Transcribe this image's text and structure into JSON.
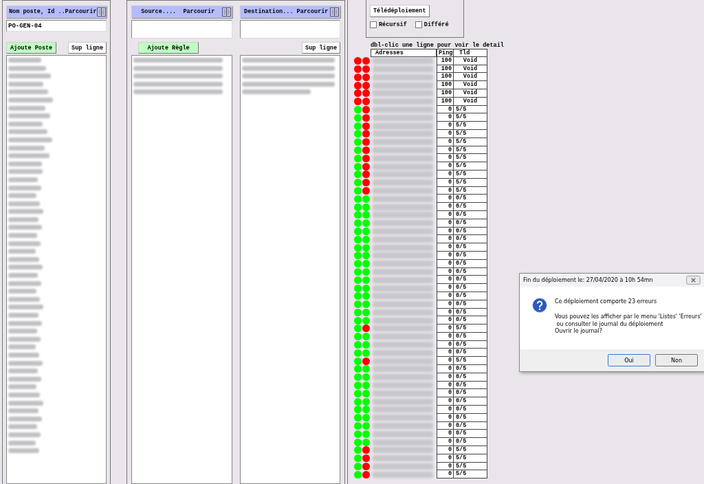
{
  "host_panel": {
    "header": "Nom poste, Id ..Parcourir",
    "value": "PO-GEN-04",
    "buttons": [
      {
        "label": "Ajoute Poste",
        "kind": "accent"
      },
      {
        "label": "Sup ligne",
        "kind": "plain"
      }
    ]
  },
  "rules_panel": {
    "source_header": "Source....  Parcourir",
    "destination_header": "Destination... Parcourir",
    "buttons": [
      {
        "label": "Ajoute Règle",
        "kind": "accent"
      },
      {
        "label": "Sup ligne",
        "kind": "plain"
      }
    ]
  },
  "deploy": {
    "button": "Télédéploiement",
    "options": [
      {
        "label": "Récursif",
        "checked": false
      },
      {
        "label": "Différé",
        "checked": false
      }
    ]
  },
  "hint": "dbl-clic une ligne pour voir le detail",
  "table": {
    "columns": [
      "Adresses",
      "Ping",
      "Tld"
    ],
    "rows": [
      {
        "dots": [
          {
            "color": "#ff0000"
          },
          {
            "color": "#ff0000"
          }
        ],
        "ping": "100",
        "tld": "Void"
      },
      {
        "dots": [
          {
            "color": "#ff0000"
          },
          {
            "color": "#ff0000"
          }
        ],
        "ping": "100",
        "tld": "Void"
      },
      {
        "dots": [
          {
            "color": "#ff0000"
          },
          {
            "color": "#ff0000"
          }
        ],
        "ping": "100",
        "tld": "Void"
      },
      {
        "dots": [
          {
            "color": "#ff0000"
          },
          {
            "color": "#ff0000"
          }
        ],
        "ping": "100",
        "tld": "Void"
      },
      {
        "dots": [
          {
            "color": "#ff0000"
          },
          {
            "color": "#ff0000"
          }
        ],
        "ping": "100",
        "tld": "Void"
      },
      {
        "dots": [
          {
            "color": "#ff0000"
          },
          {
            "color": "#ff0000"
          }
        ],
        "ping": "100",
        "tld": "Void"
      },
      {
        "dots": [
          {
            "color": "#00ff00"
          },
          {
            "color": "#ff0000"
          }
        ],
        "ping": "0",
        "tld": "5/5"
      },
      {
        "dots": [
          {
            "color": "#00ff00"
          },
          {
            "color": "#ff0000"
          }
        ],
        "ping": "0",
        "tld": "5/5"
      },
      {
        "dots": [
          {
            "color": "#00ff00"
          },
          {
            "color": "#ff0000"
          }
        ],
        "ping": "0",
        "tld": "5/5"
      },
      {
        "dots": [
          {
            "color": "#00ff00"
          },
          {
            "color": "#ff0000"
          }
        ],
        "ping": "0",
        "tld": "5/5"
      },
      {
        "dots": [
          {
            "color": "#00ff00"
          },
          {
            "color": "#ff0000"
          }
        ],
        "ping": "0",
        "tld": "5/5"
      },
      {
        "dots": [
          {
            "color": "#00ff00"
          },
          {
            "color": "#ff0000"
          }
        ],
        "ping": "0",
        "tld": "5/5"
      },
      {
        "dots": [
          {
            "color": "#00ff00"
          },
          {
            "color": "#ff0000"
          }
        ],
        "ping": "0",
        "tld": "5/5"
      },
      {
        "dots": [
          {
            "color": "#00ff00"
          },
          {
            "color": "#ff0000"
          }
        ],
        "ping": "0",
        "tld": "5/5"
      },
      {
        "dots": [
          {
            "color": "#00ff00"
          },
          {
            "color": "#ff0000"
          }
        ],
        "ping": "0",
        "tld": "5/5"
      },
      {
        "dots": [
          {
            "color": "#00ff00"
          },
          {
            "color": "#ff0000"
          }
        ],
        "ping": "0",
        "tld": "5/5"
      },
      {
        "dots": [
          {
            "color": "#00ff00"
          },
          {
            "color": "#ff0000"
          }
        ],
        "ping": "0",
        "tld": "5/5"
      },
      {
        "dots": [
          {
            "color": "#00ff00"
          },
          {
            "color": "#00ff00"
          }
        ],
        "ping": "0",
        "tld": "0/5"
      },
      {
        "dots": [
          {
            "color": "#00ff00"
          },
          {
            "color": "#00ff00"
          }
        ],
        "ping": "0",
        "tld": "0/5"
      },
      {
        "dots": [
          {
            "color": "#00ff00"
          },
          {
            "color": "#00ff00"
          }
        ],
        "ping": "0",
        "tld": "0/5"
      },
      {
        "dots": [
          {
            "color": "#00ff00"
          },
          {
            "color": "#00ff00"
          }
        ],
        "ping": "0",
        "tld": "0/5"
      },
      {
        "dots": [
          {
            "color": "#00ff00"
          },
          {
            "color": "#00ff00"
          }
        ],
        "ping": "0",
        "tld": "0/5"
      },
      {
        "dots": [
          {
            "color": "#00ff00"
          },
          {
            "color": "#00ff00"
          }
        ],
        "ping": "0",
        "tld": "0/5"
      },
      {
        "dots": [
          {
            "color": "#00ff00"
          },
          {
            "color": "#00ff00"
          }
        ],
        "ping": "0",
        "tld": "0/5"
      },
      {
        "dots": [
          {
            "color": "#00ff00"
          },
          {
            "color": "#00ff00"
          }
        ],
        "ping": "0",
        "tld": "0/5"
      },
      {
        "dots": [
          {
            "color": "#00ff00"
          },
          {
            "color": "#00ff00"
          }
        ],
        "ping": "0",
        "tld": "0/5"
      },
      {
        "dots": [
          {
            "color": "#00ff00"
          },
          {
            "color": "#00ff00"
          }
        ],
        "ping": "0",
        "tld": "0/5"
      },
      {
        "dots": [
          {
            "color": "#00ff00"
          },
          {
            "color": "#00ff00"
          }
        ],
        "ping": "0",
        "tld": "0/5"
      },
      {
        "dots": [
          {
            "color": "#00ff00"
          },
          {
            "color": "#00ff00"
          }
        ],
        "ping": "0",
        "tld": "0/5"
      },
      {
        "dots": [
          {
            "color": "#00ff00"
          },
          {
            "color": "#00ff00"
          }
        ],
        "ping": "0",
        "tld": "0/5"
      },
      {
        "dots": [
          {
            "color": "#00ff00"
          },
          {
            "color": "#00ff00"
          }
        ],
        "ping": "0",
        "tld": "0/5"
      },
      {
        "dots": [
          {
            "color": "#00ff00"
          },
          {
            "color": "#00ff00"
          }
        ],
        "ping": "0",
        "tld": "0/5"
      },
      {
        "dots": [
          {
            "color": "#00ff00"
          },
          {
            "color": "#00ff00"
          }
        ],
        "ping": "0",
        "tld": "0/5"
      },
      {
        "dots": [
          {
            "color": "#00ff00"
          },
          {
            "color": "#ff0000"
          }
        ],
        "ping": "0",
        "tld": "5/5"
      },
      {
        "dots": [
          {
            "color": "#00ff00"
          },
          {
            "color": "#00ff00"
          }
        ],
        "ping": "0",
        "tld": "0/5"
      },
      {
        "dots": [
          {
            "color": "#00ff00"
          },
          {
            "color": "#00ff00"
          }
        ],
        "ping": "0",
        "tld": "0/5"
      },
      {
        "dots": [
          {
            "color": "#00ff00"
          },
          {
            "color": "#00ff00"
          }
        ],
        "ping": "0",
        "tld": "0/5"
      },
      {
        "dots": [
          {
            "color": "#00ff00"
          },
          {
            "color": "#ff0000"
          }
        ],
        "ping": "0",
        "tld": "5/5"
      },
      {
        "dots": [
          {
            "color": "#00ff00"
          },
          {
            "color": "#00ff00"
          }
        ],
        "ping": "0",
        "tld": "0/5"
      },
      {
        "dots": [
          {
            "color": "#00ff00"
          },
          {
            "color": "#00ff00"
          }
        ],
        "ping": "0",
        "tld": "0/5"
      },
      {
        "dots": [
          {
            "color": "#00ff00"
          },
          {
            "color": "#00ff00"
          }
        ],
        "ping": "0",
        "tld": "0/5"
      },
      {
        "dots": [
          {
            "color": "#00ff00"
          },
          {
            "color": "#00ff00"
          }
        ],
        "ping": "0",
        "tld": "0/5"
      },
      {
        "dots": [
          {
            "color": "#00ff00"
          },
          {
            "color": "#00ff00"
          }
        ],
        "ping": "0",
        "tld": "0/5"
      },
      {
        "dots": [
          {
            "color": "#00ff00"
          },
          {
            "color": "#00ff00"
          }
        ],
        "ping": "0",
        "tld": "0/5"
      },
      {
        "dots": [
          {
            "color": "#00ff00"
          },
          {
            "color": "#00ff00"
          }
        ],
        "ping": "0",
        "tld": "0/5"
      },
      {
        "dots": [
          {
            "color": "#00ff00"
          },
          {
            "color": "#00ff00"
          }
        ],
        "ping": "0",
        "tld": "0/5"
      },
      {
        "dots": [
          {
            "color": "#00ff00"
          },
          {
            "color": "#00ff00"
          }
        ],
        "ping": "0",
        "tld": "0/5"
      },
      {
        "dots": [
          {
            "color": "#00ff00"
          },
          {
            "color": "#00ff00"
          }
        ],
        "ping": "0",
        "tld": "0/5"
      },
      {
        "dots": [
          {
            "color": "#00ff00"
          },
          {
            "color": "#ff0000"
          }
        ],
        "ping": "0",
        "tld": "5/5"
      },
      {
        "dots": [
          {
            "color": "#00ff00"
          },
          {
            "color": "#ff0000"
          }
        ],
        "ping": "0",
        "tld": "5/5"
      },
      {
        "dots": [
          {
            "color": "#00ff00"
          },
          {
            "color": "#ff0000"
          }
        ],
        "ping": "0",
        "tld": "5/5"
      },
      {
        "dots": [
          {
            "color": "#00ff00"
          },
          {
            "color": "#ff0000"
          }
        ],
        "ping": "0",
        "tld": "5/5"
      }
    ]
  },
  "dialog": {
    "title": "Fin du déploiement le: 27/04/2020 à 10h  54mn",
    "summary": "Ce déploiement comporte  23 erreurs",
    "message": "Vous pouvez les afficher par le menu 'Listes' 'Erreurs'\n ou consulter le journal du déploiement\nOuvrir le journal?",
    "buttons": [
      "Oui",
      "Non"
    ]
  }
}
